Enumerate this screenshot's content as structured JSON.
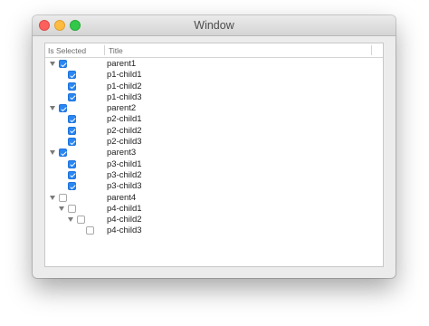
{
  "window": {
    "title": "Window"
  },
  "columns": {
    "selected": "Is Selected",
    "title": "Title"
  },
  "rows": [
    {
      "title": "parent1",
      "level": 0,
      "checked": true,
      "disclosure": true
    },
    {
      "title": "p1-child1",
      "level": 1,
      "checked": true,
      "disclosure": false
    },
    {
      "title": "p1-child2",
      "level": 1,
      "checked": true,
      "disclosure": false
    },
    {
      "title": "p1-child3",
      "level": 1,
      "checked": true,
      "disclosure": false
    },
    {
      "title": "parent2",
      "level": 0,
      "checked": true,
      "disclosure": true
    },
    {
      "title": "p2-child1",
      "level": 1,
      "checked": true,
      "disclosure": false
    },
    {
      "title": "p2-child2",
      "level": 1,
      "checked": true,
      "disclosure": false
    },
    {
      "title": "p2-child3",
      "level": 1,
      "checked": true,
      "disclosure": false
    },
    {
      "title": "parent3",
      "level": 0,
      "checked": true,
      "disclosure": true
    },
    {
      "title": "p3-child1",
      "level": 1,
      "checked": true,
      "disclosure": false
    },
    {
      "title": "p3-child2",
      "level": 1,
      "checked": true,
      "disclosure": false
    },
    {
      "title": "p3-child3",
      "level": 1,
      "checked": true,
      "disclosure": false
    },
    {
      "title": "parent4",
      "level": 0,
      "checked": false,
      "disclosure": true
    },
    {
      "title": "p4-child1",
      "level": 1,
      "checked": false,
      "disclosure": true
    },
    {
      "title": "p4-child2",
      "level": 2,
      "checked": false,
      "disclosure": true
    },
    {
      "title": "p4-child3",
      "level": 3,
      "checked": false,
      "disclosure": false
    }
  ],
  "colors": {
    "checkbox_on": "#2a86f2",
    "close": "#fc605c",
    "minimize": "#fdbc40",
    "maximize": "#34c84a"
  },
  "icons": {
    "expanded": "disclosure-triangle-down-icon",
    "checked": "checkbox-checked-icon",
    "unchecked": "checkbox-unchecked-icon"
  }
}
